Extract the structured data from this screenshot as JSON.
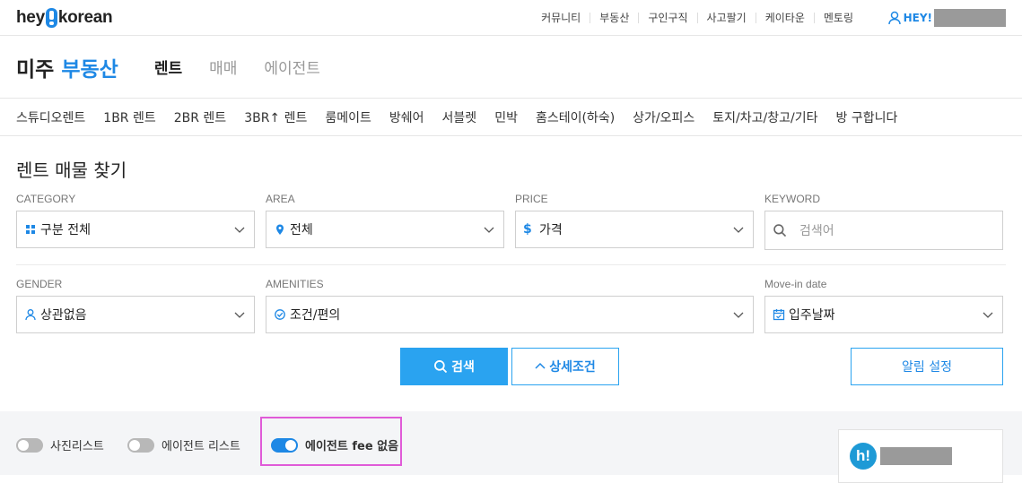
{
  "logo": {
    "left": "hey",
    "right": "korean"
  },
  "topnav": [
    "커뮤니티",
    "부동산",
    "구인구직",
    "사고팔기",
    "케이타운",
    "멘토링"
  ],
  "user": {
    "greeting": "HEY!"
  },
  "header": {
    "brand_main": "미주",
    "brand_accent": "부동산",
    "tabs": [
      "렌트",
      "매매",
      "에이전트"
    ]
  },
  "categories": [
    "스튜디오렌트",
    "1BR 렌트",
    "2BR 렌트",
    "3BR↑ 렌트",
    "룸메이트",
    "방쉐어",
    "서블렛",
    "민박",
    "홈스테이(하숙)",
    "상가/오피스",
    "토지/차고/창고/기타",
    "방 구합니다"
  ],
  "search": {
    "title": "렌트 매물 찾기",
    "category": {
      "label": "CATEGORY",
      "value": "구분 전체"
    },
    "area": {
      "label": "AREA",
      "value": "전체"
    },
    "price": {
      "label": "PRICE",
      "value": "가격"
    },
    "keyword": {
      "label": "KEYWORD",
      "placeholder": "검색어"
    },
    "gender": {
      "label": "GENDER",
      "value": "상관없음"
    },
    "amenities": {
      "label": "AMENITIES",
      "value": "조건/편의"
    },
    "movein": {
      "label": "Move-in date",
      "value": "입주날짜"
    }
  },
  "buttons": {
    "search": "검색",
    "detail": "상세조건",
    "alert": "알림 설정"
  },
  "toggles": [
    {
      "label": "사진리스트",
      "on": false
    },
    {
      "label": "에이전트 리스트",
      "on": false
    },
    {
      "label": "에이전트 fee 없음",
      "on": true
    }
  ],
  "ad": {
    "badge": "h!"
  },
  "colors": {
    "accent": "#1e88e5",
    "button": "#2aa3f0",
    "highlight": "#e05bd8"
  }
}
